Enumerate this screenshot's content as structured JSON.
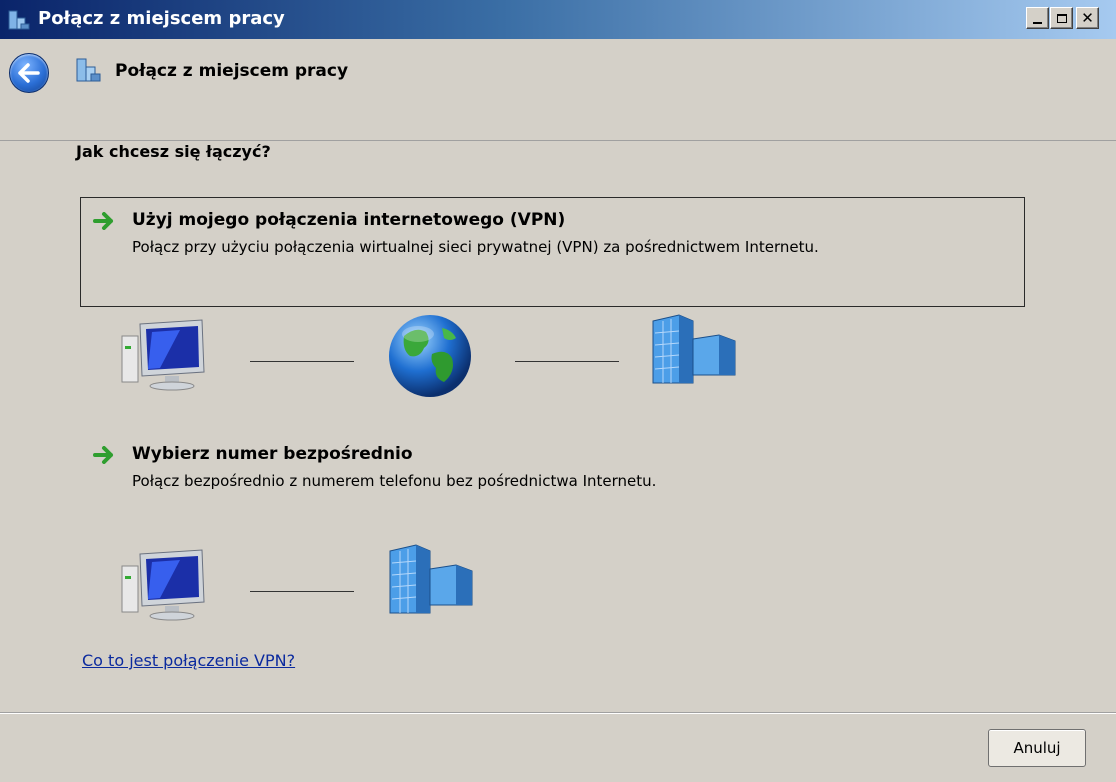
{
  "window": {
    "title": "Połącz z miejscem pracy"
  },
  "header": {
    "title": "Połącz z miejscem pracy"
  },
  "main": {
    "question": "Jak chcesz się łączyć?",
    "options": [
      {
        "title": "Użyj mojego połączenia internetowego (VPN)",
        "description": "Połącz przy użyciu połączenia wirtualnej sieci prywatnej (VPN) za pośrednictwem Internetu.",
        "diagram": [
          "computer-icon",
          "globe-icon",
          "building-icon"
        ]
      },
      {
        "title": "Wybierz numer bezpośrednio",
        "description": "Połącz bezpośrednio z numerem telefonu bez pośrednictwa Internetu.",
        "diagram": [
          "computer-icon",
          "building-icon"
        ]
      }
    ],
    "help_link": "Co to jest połączenie VPN?"
  },
  "footer": {
    "cancel_label": "Anuluj"
  },
  "colors": {
    "title_bar_start": "#0a246a",
    "title_bar_end": "#a6caf0",
    "dialog_bg": "#d4d0c8",
    "link": "#0b2a9e",
    "arrow": "#2f9e2f"
  }
}
